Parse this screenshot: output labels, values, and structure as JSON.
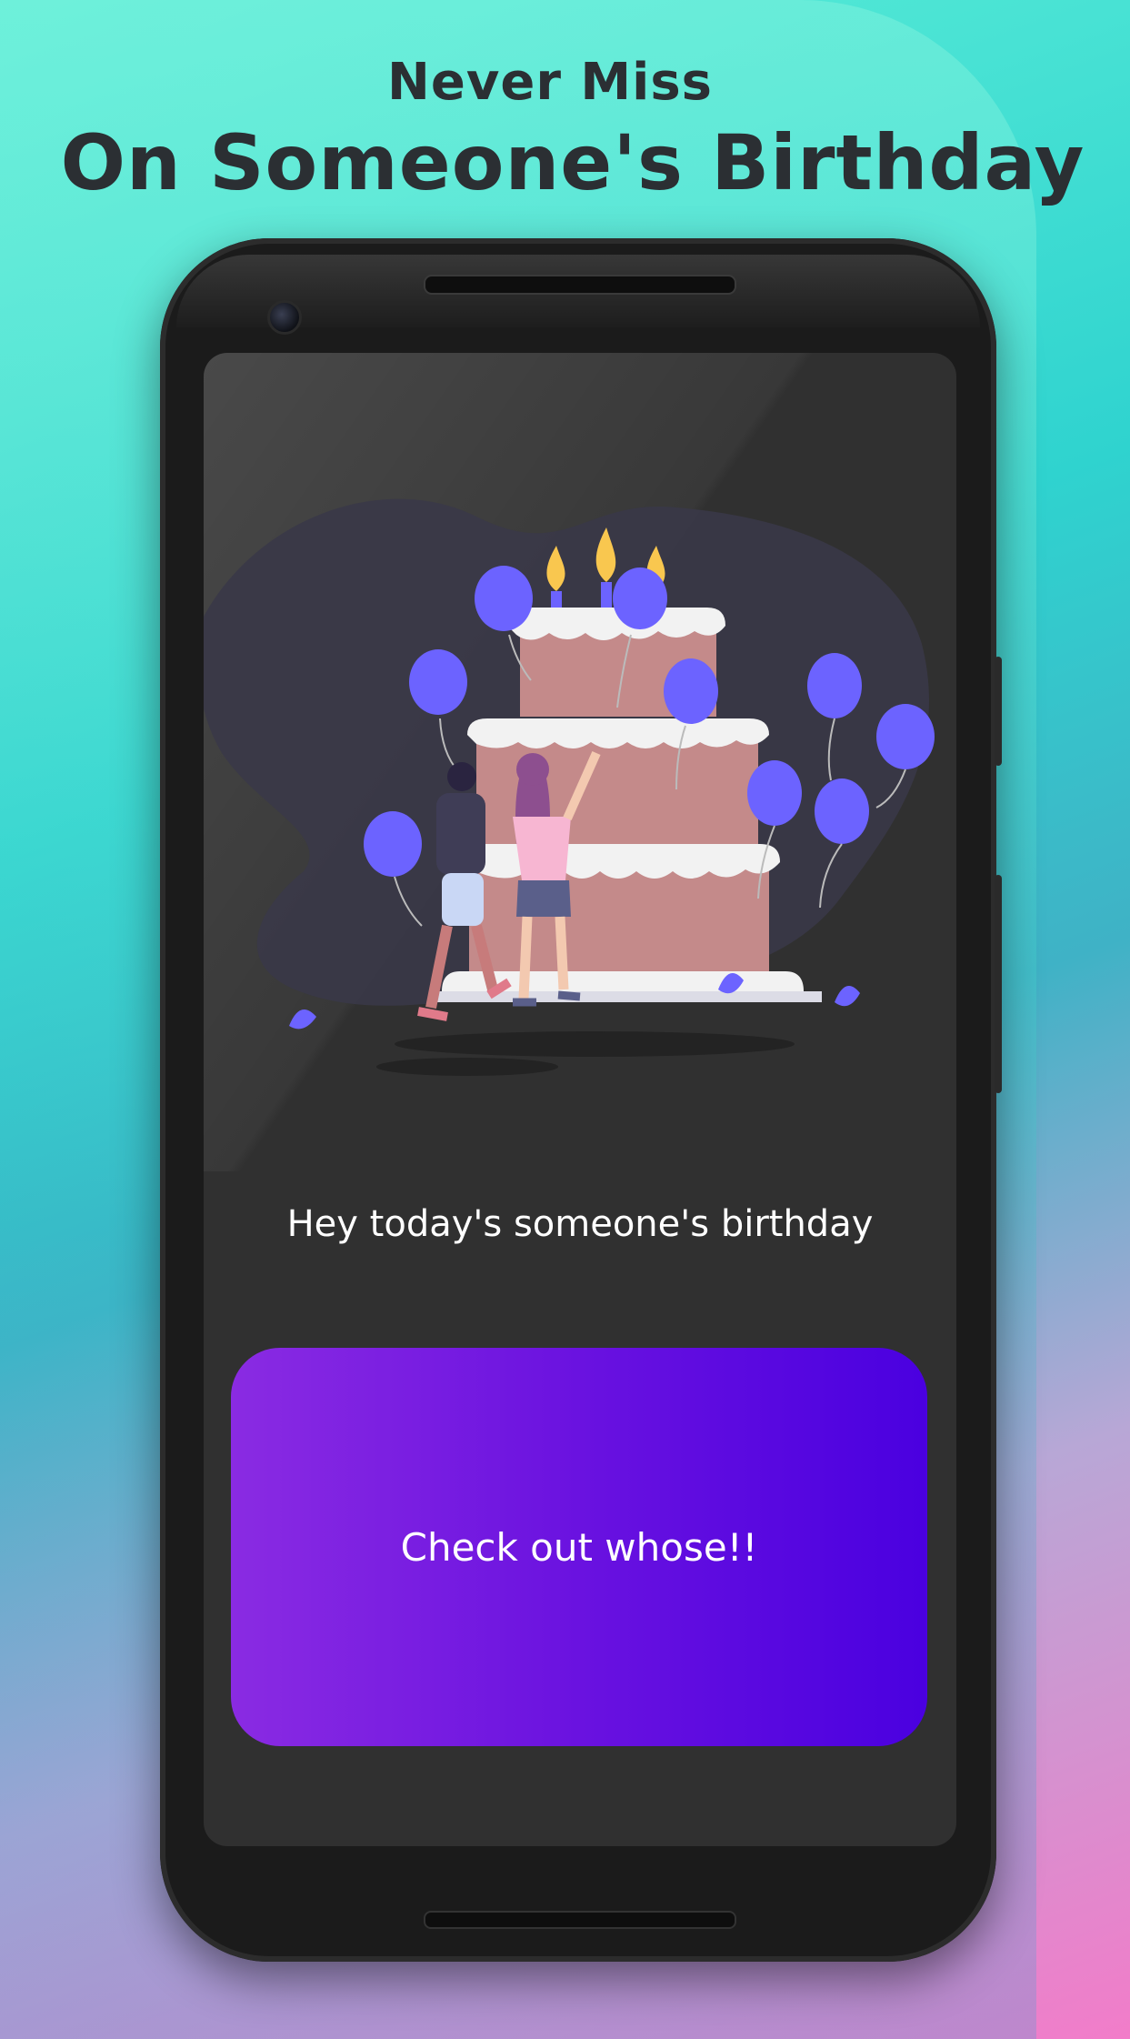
{
  "header": {
    "line1": "Never Miss",
    "line2": "On Someone's Birthday"
  },
  "screen": {
    "message": "Hey today's someone's birthday",
    "button_label": "Check out whose!!"
  },
  "colors": {
    "screen_bg": "#303030",
    "button_gradient_start": "#8a2be2",
    "button_gradient_end": "#4a00e0",
    "balloon": "#6c63ff",
    "cake": "#c48a8a"
  }
}
